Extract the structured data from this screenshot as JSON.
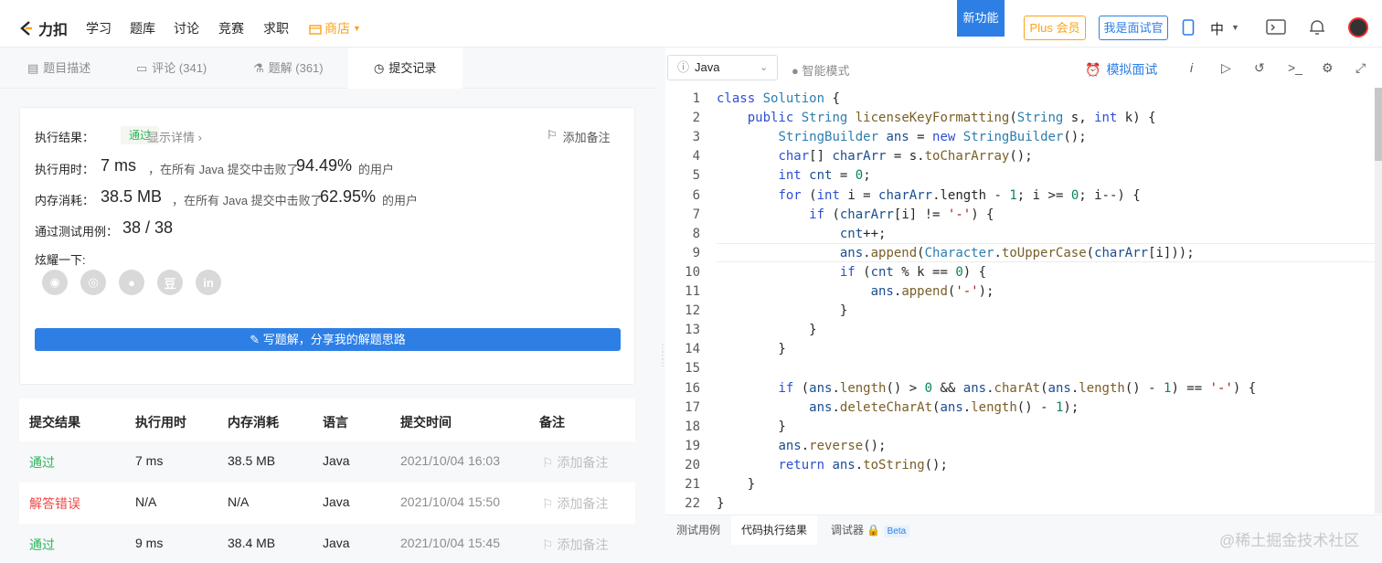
{
  "nav": {
    "logo_text": "力扣",
    "links": [
      "学习",
      "题库",
      "讨论",
      "竞赛",
      "求职"
    ],
    "shop": "商店",
    "new_feature": "新功能",
    "plus": "Plus 会员",
    "interviewer": "我是面试官",
    "lang": "中"
  },
  "tabs": [
    {
      "label": "题目描述"
    },
    {
      "label": "评论 (341)"
    },
    {
      "label": "题解 (361)"
    },
    {
      "label": "提交记录"
    }
  ],
  "result": {
    "label": "执行结果：",
    "status": "通过",
    "details": "显示详情 ›",
    "note": "添加备注",
    "time_label": "执行用时：",
    "time_value": "7 ms",
    "time_mid": "，在所有 Java 提交中击败了",
    "time_pct": "94.49%",
    "time_tail": "的用户",
    "mem_label": "内存消耗：",
    "mem_value": "38.5 MB",
    "mem_mid": "，在所有 Java 提交中击败了",
    "mem_pct": "62.95%",
    "mem_tail": "的用户",
    "tests_label": "通过测试用例：",
    "tests_value": "38 / 38",
    "share_label": "炫耀一下:",
    "write_btn": "写题解，分享我的解题思路"
  },
  "table": {
    "headers": [
      "提交结果",
      "执行用时",
      "内存消耗",
      "语言",
      "提交时间",
      "备注"
    ],
    "rows": [
      {
        "result": "通过",
        "time": "7 ms",
        "mem": "38.5 MB",
        "lang": "Java",
        "date": "2021/10/04 16:03",
        "note": "添加备注"
      },
      {
        "result": "解答错误",
        "time": "N/A",
        "mem": "N/A",
        "lang": "Java",
        "date": "2021/10/04 15:50",
        "note": "添加备注"
      },
      {
        "result": "通过",
        "time": "9 ms",
        "mem": "38.4 MB",
        "lang": "Java",
        "date": "2021/10/04 15:45",
        "note": "添加备注"
      }
    ]
  },
  "editor": {
    "language": "Java",
    "smart_mode": "智能模式",
    "mock_interview": "模拟面试"
  },
  "code": [
    "class Solution {",
    "    public String licenseKeyFormatting(String s, int k) {",
    "        StringBuilder ans = new StringBuilder();",
    "        char[] charArr = s.toCharArray();",
    "        int cnt = 0;",
    "        for (int i = charArr.length - 1; i >= 0; i--) {",
    "            if (charArr[i] != '-') {",
    "                cnt++;",
    "                ans.append(Character.toUpperCase(charArr[i]));",
    "                if (cnt % k == 0) {",
    "                    ans.append('-');",
    "                }",
    "            }",
    "        }",
    "",
    "        if (ans.length() > 0 && ans.charAt(ans.length() - 1) == '-') {",
    "            ans.deleteCharAt(ans.length() - 1);",
    "        }",
    "        ans.reverse();",
    "        return ans.toString();",
    "    }",
    "}"
  ],
  "bottom": {
    "tabs": [
      "测试用例",
      "代码执行结果",
      "调试器"
    ],
    "beta": "Beta"
  },
  "watermark": "@稀土掘金技术社区"
}
